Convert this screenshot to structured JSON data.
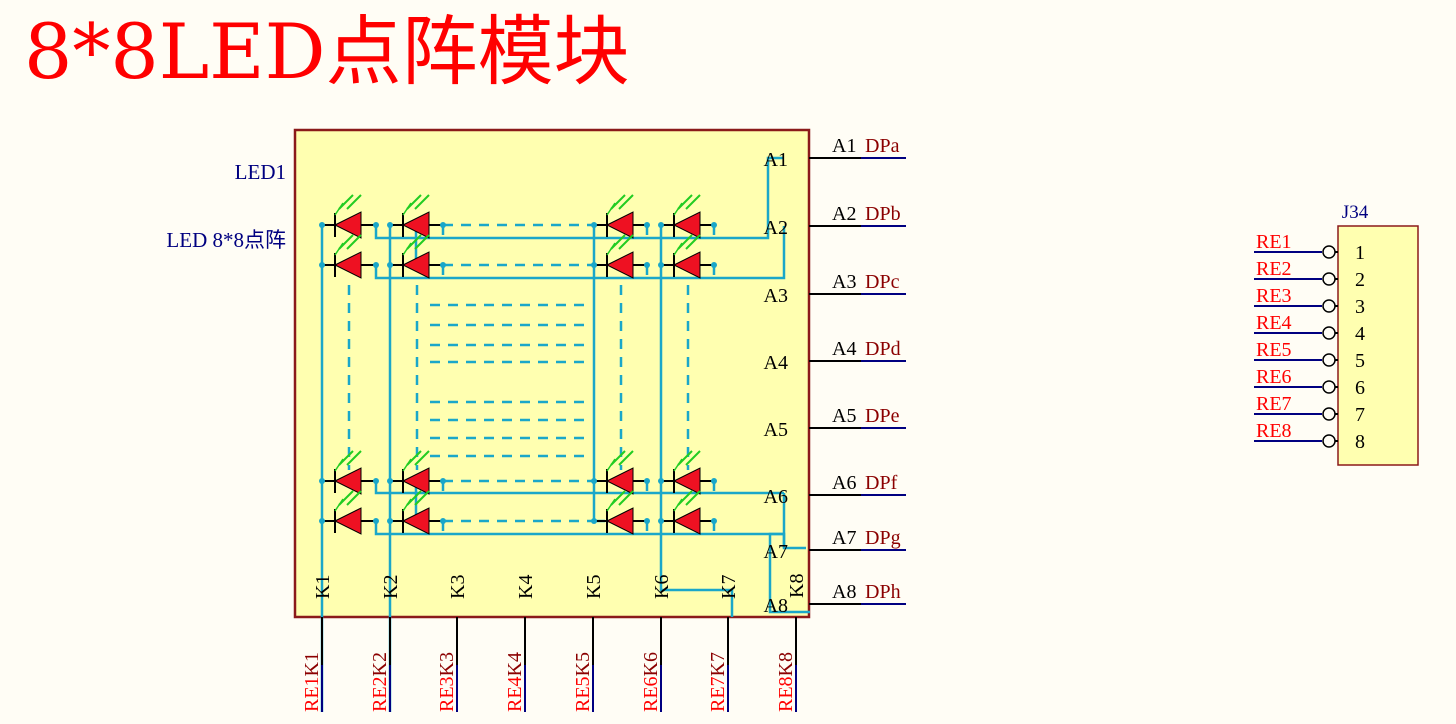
{
  "title": "8*8LED点阵模块",
  "led": {
    "designator": "LED1",
    "comment": "LED 8*8点阵",
    "anode_pins": [
      "A1",
      "A2",
      "A3",
      "A4",
      "A5",
      "A6",
      "A7",
      "A8"
    ],
    "cathode_pins": [
      "K1",
      "K2",
      "K3",
      "K4",
      "K5",
      "K6",
      "K7",
      "K8"
    ]
  },
  "anode_nets": [
    {
      "pin": "A1",
      "net": "DPa"
    },
    {
      "pin": "A2",
      "net": "DPb"
    },
    {
      "pin": "A3",
      "net": "DPc"
    },
    {
      "pin": "A4",
      "net": "DPd"
    },
    {
      "pin": "A5",
      "net": "DPe"
    },
    {
      "pin": "A6",
      "net": "DPf"
    },
    {
      "pin": "A7",
      "net": "DPg"
    },
    {
      "pin": "A8",
      "net": "DPh"
    }
  ],
  "cathode_nets": [
    {
      "net": "RE1",
      "pin": "K1"
    },
    {
      "net": "RE2",
      "pin": "K2"
    },
    {
      "net": "RE3",
      "pin": "K3"
    },
    {
      "net": "RE4",
      "pin": "K4"
    },
    {
      "net": "RE5",
      "pin": "K5"
    },
    {
      "net": "RE6",
      "pin": "K6"
    },
    {
      "net": "RE7",
      "pin": "K7"
    },
    {
      "net": "RE8",
      "pin": "K8"
    }
  ],
  "connector": {
    "designator": "J34",
    "pins": [
      "1",
      "2",
      "3",
      "4",
      "5",
      "6",
      "7",
      "8"
    ],
    "nets": [
      "RE1",
      "RE2",
      "RE3",
      "RE4",
      "RE5",
      "RE6",
      "RE7",
      "RE8"
    ]
  },
  "colors": {
    "title": "#FF0000",
    "wire": "#1AA7C9",
    "body_fill": "#FFFFB0",
    "body_stroke": "#8B1A1A",
    "net_red": "#FF0000",
    "net_dark": "#8B0000",
    "label_blue": "#000080"
  }
}
